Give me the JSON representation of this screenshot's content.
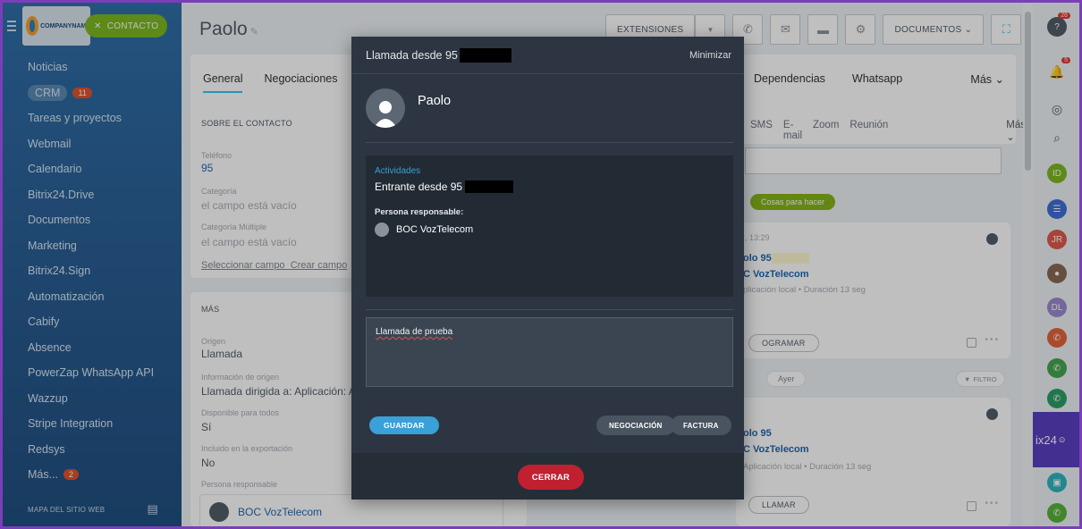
{
  "sidebar": {
    "contact_button": "CONTACTO",
    "logo_text": "COMPANYNAME",
    "items": [
      {
        "label": "Noticias"
      },
      {
        "label": "CRM",
        "badge": "11"
      },
      {
        "label": "Tareas y proyectos"
      },
      {
        "label": "Webmail"
      },
      {
        "label": "Calendario"
      },
      {
        "label": "Bitrix24.Drive"
      },
      {
        "label": "Documentos"
      },
      {
        "label": "Marketing"
      },
      {
        "label": "Bitrix24.Sign"
      },
      {
        "label": "Automatización"
      },
      {
        "label": "Cabify"
      },
      {
        "label": "Absence"
      },
      {
        "label": "PowerZap WhatsApp API"
      },
      {
        "label": "Wazzup"
      },
      {
        "label": "Stripe Integration"
      },
      {
        "label": "Redsys"
      },
      {
        "label": "Más...",
        "badge": "2"
      }
    ],
    "sitemap": "MAPA DEL SITIO WEB"
  },
  "header": {
    "title": "Paolo",
    "extensions": "EXTENSIONES",
    "documents": "DOCUMENTOS"
  },
  "tabs": {
    "general": "General",
    "deals": "Negociaciones",
    "dependencies": "Dependencias",
    "whatsapp": "Whatsapp",
    "more": "Más"
  },
  "contact": {
    "section": "SOBRE EL CONTACTO",
    "phone_label": "Teléfono",
    "phone_value": "95",
    "category_label": "Categoría",
    "category_value": "el campo está vacío",
    "multi_category_label": "Categoría Múltiple",
    "multi_category_value": "el campo está vacío",
    "select_field": "Seleccionar campo",
    "create_field": "Crear campo"
  },
  "more_section": {
    "title": "MÁS",
    "origin_label": "Origen",
    "origin_value": "Llamada",
    "origin_info_label": "Información de origen",
    "origin_info_value": "Llamada dirigida a: Aplicación: Ap",
    "available_label": "Disponible para todos",
    "available_value": "Sí",
    "export_label": "Incluido en la exportación",
    "export_value": "No",
    "responsible_label": "Persona responsable",
    "responsible_value": "BOC VozTelecom"
  },
  "activity": {
    "tabs": [
      "SMS",
      "E-mail",
      "Zoom",
      "Reunión"
    ],
    "more": "Más",
    "todo_pill": "Cosas para hacer",
    "yesterday": "Ayer",
    "filter": "FILTRO",
    "card1": {
      "time": ", 13:29",
      "name": "olo 95",
      "company": "C VozTelecom",
      "meta": "plicación local • Duración 13 seg",
      "button": "OGRAMAR"
    },
    "card2": {
      "name": "olo 95",
      "company": "C VozTelecom",
      "meta": "Aplicación local • Duración 13 seg",
      "button": "LLAMAR"
    }
  },
  "dialog": {
    "title": "Llamada desde 95",
    "minimize": "Minimizar",
    "caller_name": "Paolo",
    "activities_label": "Actividades",
    "activity_text": "Entrante desde 95",
    "responsible_label": "Persona responsable:",
    "responsible_name": "BOC VozTelecom",
    "note": "Llamada de prueba",
    "save": "GUARDAR",
    "deal": "NEGOCIACIÓN",
    "invoice": "FACTURA",
    "close": "CERRAR"
  },
  "rail": {
    "help_badge": "26",
    "notif_badge": "5",
    "user_initials": [
      "ID",
      "JR",
      "DL"
    ],
    "b24_text": "ix24"
  }
}
